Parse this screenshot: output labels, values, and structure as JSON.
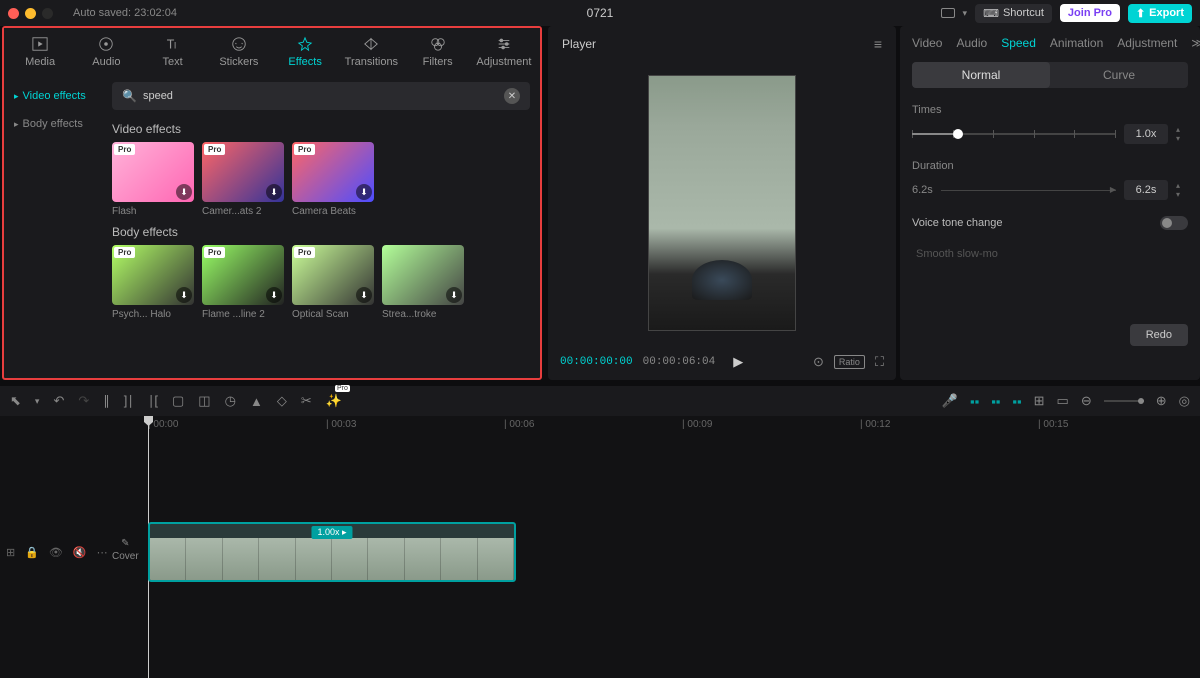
{
  "titlebar": {
    "autosave": "Auto saved: 23:02:04",
    "title": "0721",
    "shortcut": "Shortcut",
    "joinpro": "Join Pro",
    "export": "Export"
  },
  "tabs": {
    "media": "Media",
    "audio": "Audio",
    "text": "Text",
    "stickers": "Stickers",
    "effects": "Effects",
    "transitions": "Transitions",
    "filters": "Filters",
    "adjustment": "Adjustment"
  },
  "sidebar": {
    "video_effects": "Video effects",
    "body_effects": "Body effects"
  },
  "search": {
    "value": "speed",
    "placeholder": "Search"
  },
  "sections": {
    "video": "Video effects",
    "body": "Body effects"
  },
  "video_thumbs": [
    {
      "name": "Flash",
      "pro": true
    },
    {
      "name": "Camer...ats 2",
      "pro": true
    },
    {
      "name": "Camera Beats",
      "pro": true
    }
  ],
  "body_thumbs": [
    {
      "name": "Psych... Halo",
      "pro": true
    },
    {
      "name": "Flame ...line 2",
      "pro": true
    },
    {
      "name": "Optical Scan",
      "pro": true
    },
    {
      "name": "Strea...troke",
      "pro": false
    }
  ],
  "player": {
    "title": "Player",
    "time_current": "00:00:00:00",
    "time_total": "00:00:06:04",
    "ratio": "Ratio"
  },
  "inspector": {
    "tabs": {
      "video": "Video",
      "audio": "Audio",
      "speed": "Speed",
      "animation": "Animation",
      "adjustment": "Adjustment"
    },
    "seg": {
      "normal": "Normal",
      "curve": "Curve"
    },
    "times_label": "Times",
    "times_value": "1.0x",
    "duration_label": "Duration",
    "duration_start": "6.2s",
    "duration_value": "6.2s",
    "voice_label": "Voice tone change",
    "smooth": "Smooth slow-mo",
    "redo": "Redo"
  },
  "ruler": {
    "marks": [
      "00:00",
      "00:03",
      "00:06",
      "00:09",
      "00:12",
      "00:15"
    ]
  },
  "clip": {
    "label": "1.00x ▸"
  },
  "cover": "Cover"
}
